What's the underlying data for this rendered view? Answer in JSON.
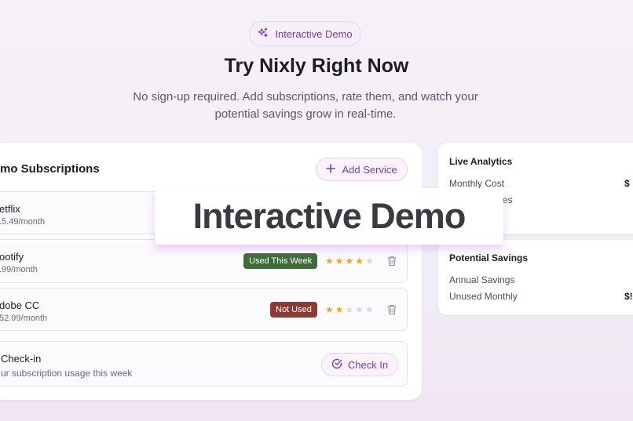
{
  "header": {
    "badge_label": "Interactive Demo",
    "title": "Try Nixly Right Now",
    "subtitle": "No sign-up required. Add subscriptions, rate them, and watch your potential savings grow in real-time."
  },
  "subscriptions": {
    "title": "mo Subscriptions",
    "add_label": "Add Service",
    "items": [
      {
        "name": "etflix",
        "price": ".5.49/month"
      },
      {
        "name": "ootify",
        "price": ".99/month",
        "status": "Used This Week",
        "rating": 4
      },
      {
        "name": "dobe CC",
        "price": "52.99/month",
        "status": "Not Used",
        "rating": 2
      }
    ],
    "checkin": {
      "title": "Check-in",
      "subtitle": "ur subscription usage this week",
      "button_label": "Check In"
    }
  },
  "analytics": {
    "title": "Live Analytics",
    "monthly_cost_label": "Monthly Cost",
    "monthly_cost_value": "$",
    "partial_label": "es"
  },
  "savings": {
    "title": "Potential Savings",
    "annual_label": "Annual Savings",
    "unused_label": "Unused Monthly",
    "unused_value": "$!"
  },
  "overlay": {
    "label": "Interactive Demo"
  },
  "colors": {
    "accent": "#7b3aa8",
    "used_badge": "#3f6b3b",
    "not_used_badge": "#8a3b33",
    "star_on": "#e8a827",
    "star_off": "#d8d6dc"
  },
  "icons": {
    "badge": "sparkles-icon",
    "add": "plus-icon",
    "delete": "trash-icon",
    "checkin": "check-circle-icon"
  }
}
